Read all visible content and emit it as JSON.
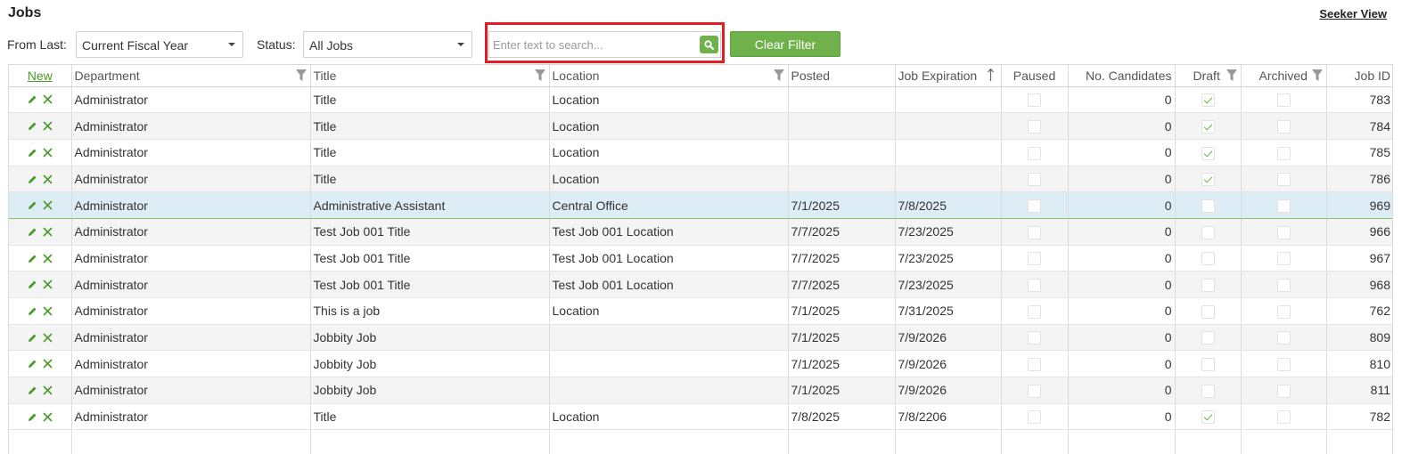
{
  "page": {
    "title": "Jobs",
    "seeker_view_label": "Seeker View"
  },
  "filters": {
    "from_last_label": "From Last:",
    "from_last_value": "Current Fiscal Year",
    "status_label": "Status:",
    "status_value": "All Jobs",
    "search_placeholder": "Enter text to search...",
    "search_value": "",
    "clear_filter_label": "Clear Filter"
  },
  "colors": {
    "accent_green": "#6fb24b",
    "highlight_red": "#e31b23",
    "selected_row": "#dcedf6"
  },
  "icons": {
    "edit": "pencil-icon",
    "delete": "close-icon",
    "filter": "funnel-icon",
    "sort": "arrow-up-icon",
    "search": "magnifier-icon",
    "dropdown": "caret-down-icon"
  },
  "table": {
    "new_label": "New",
    "columns": {
      "department": "Department",
      "title": "Title",
      "location": "Location",
      "posted": "Posted",
      "expiration": "Job Expiration",
      "paused": "Paused",
      "candidates": "No. Candidates",
      "draft": "Draft",
      "archived": "Archived",
      "job_id": "Job ID"
    },
    "sorted_column": "Job Expiration",
    "sort_direction": "ascending",
    "rows": [
      {
        "department": "Administrator",
        "title": "Title",
        "location": "Location",
        "posted": "",
        "expiration": "",
        "paused": false,
        "candidates": "0",
        "draft": true,
        "archived": false,
        "job_id": "783"
      },
      {
        "department": "Administrator",
        "title": "Title",
        "location": "Location",
        "posted": "",
        "expiration": "",
        "paused": false,
        "candidates": "0",
        "draft": true,
        "archived": false,
        "job_id": "784"
      },
      {
        "department": "Administrator",
        "title": "Title",
        "location": "Location",
        "posted": "",
        "expiration": "",
        "paused": false,
        "candidates": "0",
        "draft": true,
        "archived": false,
        "job_id": "785"
      },
      {
        "department": "Administrator",
        "title": "Title",
        "location": "Location",
        "posted": "",
        "expiration": "",
        "paused": false,
        "candidates": "0",
        "draft": true,
        "archived": false,
        "job_id": "786"
      },
      {
        "department": "Administrator",
        "title": "Administrative Assistant",
        "location": "Central Office",
        "posted": "7/1/2025",
        "expiration": "7/8/2025",
        "paused": false,
        "candidates": "0",
        "draft": false,
        "archived": false,
        "job_id": "969",
        "selected": true
      },
      {
        "department": "Administrator",
        "title": "Test Job 001 Title",
        "location": "Test Job 001 Location",
        "posted": "7/7/2025",
        "expiration": "7/23/2025",
        "paused": false,
        "candidates": "0",
        "draft": false,
        "archived": false,
        "job_id": "966"
      },
      {
        "department": "Administrator",
        "title": "Test Job 001 Title",
        "location": "Test Job 001 Location",
        "posted": "7/7/2025",
        "expiration": "7/23/2025",
        "paused": false,
        "candidates": "0",
        "draft": false,
        "archived": false,
        "job_id": "967"
      },
      {
        "department": "Administrator",
        "title": "Test Job 001 Title",
        "location": "Test Job 001 Location",
        "posted": "7/7/2025",
        "expiration": "7/23/2025",
        "paused": false,
        "candidates": "0",
        "draft": false,
        "archived": false,
        "job_id": "968"
      },
      {
        "department": "Administrator",
        "title": "This is a job",
        "location": "Location",
        "posted": "7/1/2025",
        "expiration": "7/31/2025",
        "paused": false,
        "candidates": "0",
        "draft": false,
        "archived": false,
        "job_id": "762"
      },
      {
        "department": "Administrator",
        "title": "Jobbity Job",
        "location": "",
        "posted": "7/1/2025",
        "expiration": "7/9/2026",
        "paused": false,
        "candidates": "0",
        "draft": false,
        "archived": false,
        "job_id": "809"
      },
      {
        "department": "Administrator",
        "title": "Jobbity Job",
        "location": "",
        "posted": "7/1/2025",
        "expiration": "7/9/2026",
        "paused": false,
        "candidates": "0",
        "draft": false,
        "archived": false,
        "job_id": "810"
      },
      {
        "department": "Administrator",
        "title": "Jobbity Job",
        "location": "",
        "posted": "7/1/2025",
        "expiration": "7/9/2026",
        "paused": false,
        "candidates": "0",
        "draft": false,
        "archived": false,
        "job_id": "811"
      },
      {
        "department": "Administrator",
        "title": "Title",
        "location": "Location",
        "posted": "7/8/2025",
        "expiration": "7/8/2206",
        "paused": false,
        "candidates": "0",
        "draft": true,
        "archived": false,
        "job_id": "782"
      }
    ]
  }
}
